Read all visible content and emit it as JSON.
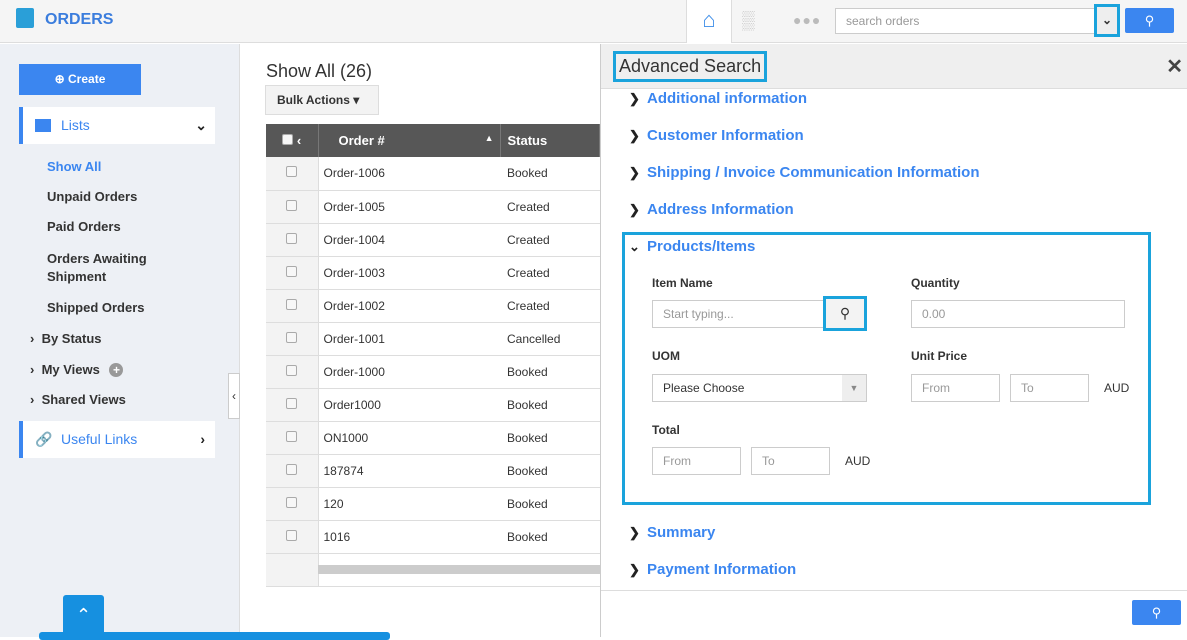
{
  "header": {
    "title": "ORDERS",
    "search_placeholder": "search orders",
    "icons": [
      "shopping-bag-icon",
      "home-icon",
      "bar-chart-icon",
      "more-icon",
      "chevron-down-icon",
      "search-icon"
    ]
  },
  "sidebar": {
    "create_label": "Create",
    "lists_label": "Lists",
    "items": [
      "Show All",
      "Unpaid Orders",
      "Paid Orders",
      "Orders Awaiting Shipment",
      "Shipped Orders"
    ],
    "tree": [
      "By Status",
      "My Views",
      "Shared Views"
    ],
    "useful_links": "Useful Links",
    "accent": "#3b86f0"
  },
  "main": {
    "title": "Show All (26)",
    "bulk_actions": "Bulk Actions",
    "columns": [
      "Order #",
      "Status"
    ],
    "rows": [
      [
        "Order-1006",
        "Booked"
      ],
      [
        "Order-1005",
        "Created"
      ],
      [
        "Order-1004",
        "Created"
      ],
      [
        "Order-1003",
        "Created"
      ],
      [
        "Order-1002",
        "Created"
      ],
      [
        "Order-1001",
        "Cancelled"
      ],
      [
        "Order-1000",
        "Booked"
      ],
      [
        "Order1000",
        "Booked"
      ],
      [
        "ON1000",
        "Booked"
      ],
      [
        "187874",
        "Booked"
      ],
      [
        "120",
        "Booked"
      ],
      [
        "1016",
        "Booked"
      ]
    ]
  },
  "panel": {
    "title": "Advanced Search",
    "sections": [
      "Additional information",
      "Customer Information",
      "Shipping / Invoice Communication Information",
      "Address Information",
      "Products/Items",
      "Summary",
      "Payment Information"
    ],
    "fields": {
      "item_name_label": "Item Name",
      "item_name_placeholder": "Start typing...",
      "quantity_label": "Quantity",
      "quantity_placeholder": "0.00",
      "uom_label": "UOM",
      "uom_value": "Please Choose",
      "unit_price_label": "Unit Price",
      "from": "From",
      "to": "To",
      "currency": "AUD",
      "total_label": "Total"
    }
  }
}
